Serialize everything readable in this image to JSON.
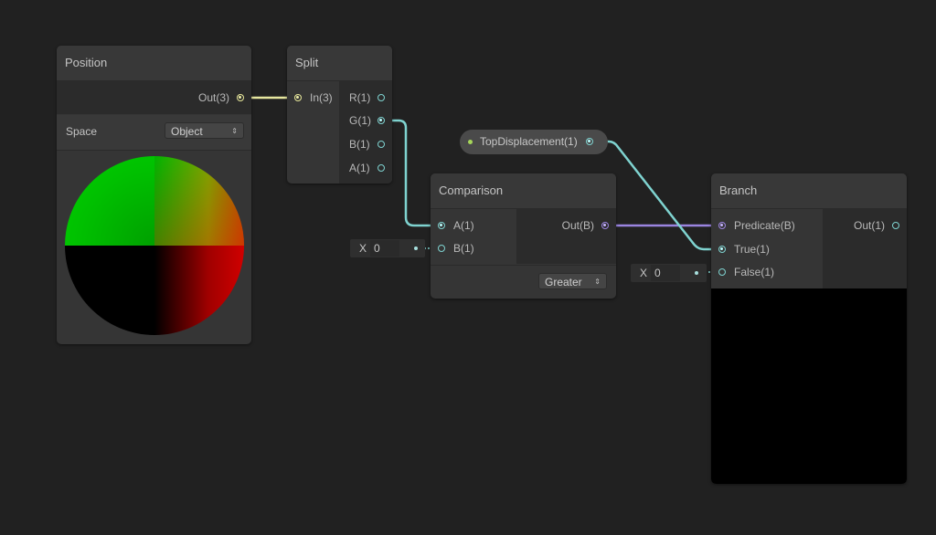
{
  "colors": {
    "background": "#212121",
    "wire_vector3": "#e8e8a0",
    "wire_vector1": "#7fd3d0",
    "wire_boolean": "#9a84e0"
  },
  "nodes": {
    "position": {
      "title": "Position",
      "output": "Out(3)",
      "space_label": "Space",
      "space_value": "Object",
      "preview": "sphere-position-preview"
    },
    "split": {
      "title": "Split",
      "input": "In(3)",
      "outputs": [
        "R(1)",
        "G(1)",
        "B(1)",
        "A(1)"
      ]
    },
    "property": {
      "label": "TopDisplacement(1)"
    },
    "comparison": {
      "title": "Comparison",
      "inputs": [
        "A(1)",
        "B(1)"
      ],
      "output": "Out(B)",
      "mode": "Greater",
      "b_field": {
        "axis_label": "X",
        "value": "0"
      }
    },
    "branch": {
      "title": "Branch",
      "inputs": [
        "Predicate(B)",
        "True(1)",
        "False(1)"
      ],
      "output": "Out(1)",
      "false_field": {
        "axis_label": "X",
        "value": "0"
      },
      "preview": "black-preview"
    }
  },
  "icons": {
    "dropdown_arrows": "⇕"
  }
}
